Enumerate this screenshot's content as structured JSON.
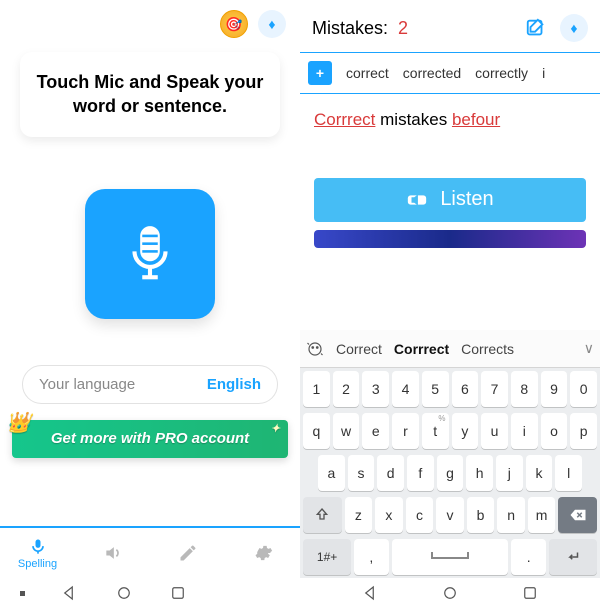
{
  "left": {
    "prompt": "Touch Mic and Speak your word or sentence.",
    "language_label": "Your language",
    "language_value": "English",
    "pro_banner": "Get more with PRO account",
    "tabs": {
      "spelling": "Spelling"
    }
  },
  "right": {
    "mistakes_label": "Mistakes:",
    "mistakes_count": "2",
    "suggestions": [
      "correct",
      "corrected",
      "correctly",
      "i"
    ],
    "sentence_parts": {
      "w1": "Corrrect",
      "w2": "mistakes",
      "w3": "befour"
    },
    "listen_label": "Listen"
  },
  "keyboard": {
    "suggestions": {
      "a": "Correct",
      "b": "Corrrect",
      "c": "Corrects"
    },
    "row1": [
      "1",
      "2",
      "3",
      "4",
      "5",
      "6",
      "7",
      "8",
      "9",
      "0"
    ],
    "row2": [
      "q",
      "w",
      "e",
      "r",
      "t",
      "y",
      "u",
      "i",
      "o",
      "p"
    ],
    "row2_hints": [
      "",
      "",
      "",
      "",
      "%",
      "",
      "",
      "",
      "",
      ""
    ],
    "row3": [
      "a",
      "s",
      "d",
      "f",
      "g",
      "h",
      "j",
      "k",
      "l"
    ],
    "row4": [
      "z",
      "x",
      "c",
      "v",
      "b",
      "n",
      "m"
    ],
    "sym_key": "1#+",
    "comma": ",",
    "period": "."
  }
}
